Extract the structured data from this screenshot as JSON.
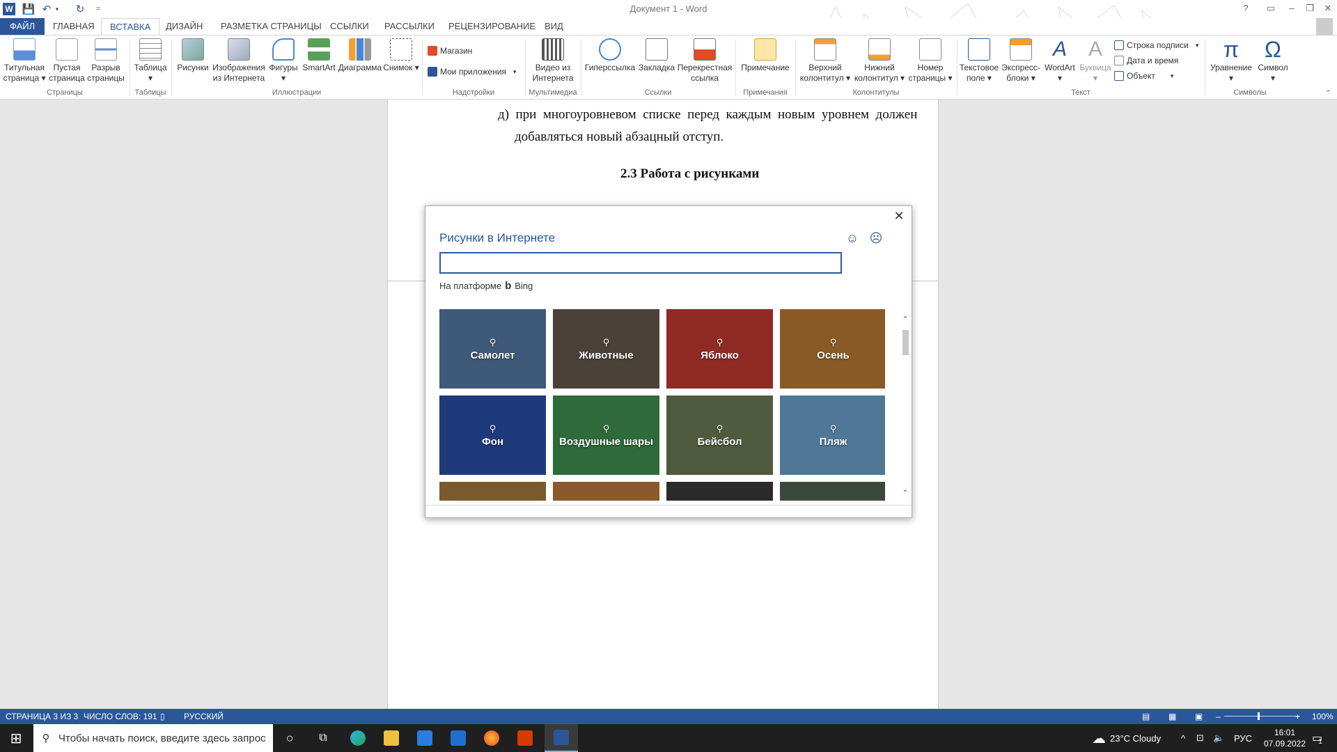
{
  "window": {
    "title": "Документ 1 - Word",
    "help": "?",
    "minimize": "–",
    "maximize": "❐",
    "close": "✕"
  },
  "quick_access": {
    "word_icon": "W",
    "save": "💾",
    "undo": "↶",
    "undo_arrow": "▾",
    "redo": "↻",
    "customize": "="
  },
  "tabs": [
    {
      "label": "ФАЙЛ"
    },
    {
      "label": "ГЛАВНАЯ"
    },
    {
      "label": "ВСТАВКА"
    },
    {
      "label": "ДИЗАЙН"
    },
    {
      "label": "РАЗМЕТКА СТРАНИЦЫ"
    },
    {
      "label": "ССЫЛКИ"
    },
    {
      "label": "РАССЫЛКИ"
    },
    {
      "label": "РЕЦЕНЗИРОВАНИЕ"
    },
    {
      "label": "ВИД"
    }
  ],
  "ribbon": {
    "buttons": [
      {
        "label": "Титульная страница ▾",
        "icon": "title-page-icon"
      },
      {
        "label": "Пустая страница",
        "icon": "blank-page-icon"
      },
      {
        "label": "Разрыв страницы",
        "icon": "page-break-icon"
      },
      {
        "label": "Таблица ▾",
        "icon": "table-icon"
      },
      {
        "label": "Рисунки",
        "icon": "pictures-icon"
      },
      {
        "label": "Изображения из Интернета",
        "icon": "online-pictures-icon"
      },
      {
        "label": "Фигуры ▾",
        "icon": "shapes-icon"
      },
      {
        "label": "SmartArt",
        "icon": "smartart-icon"
      },
      {
        "label": "Диаграмма",
        "icon": "chart-icon"
      },
      {
        "label": "Снимок ▾",
        "icon": "screenshot-icon"
      },
      {
        "label": "Видео из Интернета",
        "icon": "online-video-icon"
      },
      {
        "label": "Гиперссылка",
        "icon": "hyperlink-icon"
      },
      {
        "label": "Закладка",
        "icon": "bookmark-icon"
      },
      {
        "label": "Перекрестная ссылка",
        "icon": "cross-reference-icon"
      },
      {
        "label": "Примечание",
        "icon": "comment-icon"
      },
      {
        "label": "Верхний колонтитул ▾",
        "icon": "header-icon"
      },
      {
        "label": "Нижний колонтитул ▾",
        "icon": "footer-icon"
      },
      {
        "label": "Номер страницы ▾",
        "icon": "page-number-icon"
      },
      {
        "label": "Текстовое поле ▾",
        "icon": "text-box-icon"
      },
      {
        "label": "Экспресс-блоки ▾",
        "icon": "quick-parts-icon"
      },
      {
        "label": "WordArt ▾",
        "icon": "wordart-icon"
      },
      {
        "label": "Буквица ▾",
        "icon": "drop-cap-icon"
      },
      {
        "label": "Уравнение ▾",
        "icon": "equation-icon"
      },
      {
        "label": "Символ ▾",
        "icon": "symbol-icon"
      }
    ],
    "small": {
      "store": "Магазин",
      "my_apps": "Мои приложения",
      "my_apps_arrow": "▾",
      "signature_line": "Строка подписи",
      "signature_arrow": "▾",
      "date_time": "Дата и время",
      "object": "Объект",
      "object_arrow": "▾"
    },
    "groups": [
      {
        "label": "Страницы"
      },
      {
        "label": "Таблицы"
      },
      {
        "label": "Иллюстрации"
      },
      {
        "label": "Надстройки"
      },
      {
        "label": "Мультимедиа"
      },
      {
        "label": "Ссылки"
      },
      {
        "label": "Примечания"
      },
      {
        "label": "Колонтитулы"
      },
      {
        "label": "Текст"
      },
      {
        "label": "Символы"
      }
    ],
    "equation_glyph": "π",
    "symbol_glyph": "Ω",
    "wordart_glyph": "A",
    "dropcap_glyph": "A",
    "collapse": "⌃"
  },
  "document": {
    "line1": "д)  при  многоуровневом  списке  перед  каждым  новым  уровнем  должен",
    "line2": "добавляться новый абзацный отступ.",
    "heading": "2.3 Работа с рисунками"
  },
  "dialog": {
    "title": "Рисунки в Интернете",
    "close": "✕",
    "smile": "☺",
    "frown": "☹",
    "search_value": "",
    "powered_by": "На платформе",
    "bing_glyph": "b",
    "bing": "Bing",
    "tiles": [
      {
        "label": "Самолет",
        "bg": "#3f5a78"
      },
      {
        "label": "Животные",
        "bg": "#4a4238"
      },
      {
        "label": "Яблоко",
        "bg": "#8f2a24"
      },
      {
        "label": "Осень",
        "bg": "#8a5a26"
      },
      {
        "label": "Фон",
        "bg": "#1e3a7a"
      },
      {
        "label": "Воздушные шары",
        "bg": "#2f6b3a"
      },
      {
        "label": "Бейсбол",
        "bg": "#4f5a3e"
      },
      {
        "label": "Пляж",
        "bg": "#4f7897"
      },
      {
        "label": "",
        "bg": "#7a5a2c"
      },
      {
        "label": "",
        "bg": "#8a5a2a"
      },
      {
        "label": "",
        "bg": "#2b2a2a"
      },
      {
        "label": "",
        "bg": "#3a4a3a"
      }
    ],
    "scroll_up": "⌃",
    "scroll_down": "⌄",
    "magnifier": "⚲"
  },
  "statusbar": {
    "page": "СТРАНИЦА 3 ИЗ 3",
    "words": "ЧИСЛО СЛОВ: 191",
    "proof_icon": "▯",
    "language": "РУССКИЙ",
    "zoom_minus": "–",
    "zoom_plus": "+",
    "zoom": "100%",
    "view_read": "▤",
    "view_print": "▦",
    "view_web": "▣"
  },
  "taskbar": {
    "start": "⊞",
    "search_placeholder": "Чтобы начать поиск, введите здесь запрос",
    "search_icon": "⚲",
    "cortana": "○",
    "taskview": "⧉",
    "weather_icon": "☁",
    "weather": "23°C  Cloudy",
    "tray_arrow": "^",
    "network": "⊡",
    "volume": "🔈",
    "lang": "РУС",
    "time": "16:01",
    "date": "07.09.2022",
    "notifications": "▭",
    "notif_count": "1"
  },
  "colors": {
    "accent": "#2b579a",
    "taskbar": "#1f1f1f"
  }
}
